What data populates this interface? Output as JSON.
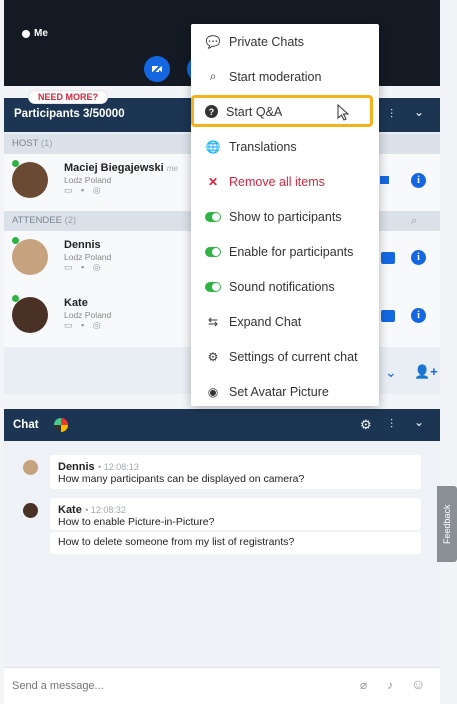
{
  "video": {
    "me_label": "Me"
  },
  "participants": {
    "badge": "NEED MORE?",
    "title": "Participants 3/50000",
    "host_section": "HOST",
    "host_count": "(1)",
    "attendee_section": "ATTENDEE",
    "attendee_count": "(2)",
    "host": {
      "name": "Maciej Biegajewski",
      "tag": "me",
      "location": "Lodz Poland"
    },
    "attendees": [
      {
        "name": "Dennis",
        "location": "Lodz Poland"
      },
      {
        "name": "Kate",
        "location": "Lodz Poland"
      }
    ]
  },
  "menu": {
    "items": [
      {
        "label": "Private Chats",
        "icon": "chats-icon"
      },
      {
        "label": "Start moderation",
        "icon": "moderation-icon"
      },
      {
        "label": "Start Q&A",
        "icon": "question-icon"
      },
      {
        "label": "Translations",
        "icon": "globe-icon"
      },
      {
        "label": "Remove all items",
        "icon": "x-icon"
      },
      {
        "label": "Show to participants",
        "icon": "toggle-on"
      },
      {
        "label": "Enable for participants",
        "icon": "toggle-on"
      },
      {
        "label": "Sound notifications",
        "icon": "toggle-on"
      },
      {
        "label": "Expand Chat",
        "icon": "expand-icon"
      },
      {
        "label": "Settings of current chat",
        "icon": "gear-icon"
      },
      {
        "label": "Set Avatar Picture",
        "icon": "avatar-icon"
      }
    ]
  },
  "chat": {
    "title": "Chat",
    "messages": [
      {
        "author": "Dennis",
        "time": "12:08:13",
        "texts": [
          "How many participants can be displayed on camera?"
        ]
      },
      {
        "author": "Kate",
        "time": "12:08:32",
        "texts": [
          "How to enable Picture-in-Picture?",
          "How to delete someone from my list of registrants?"
        ]
      }
    ],
    "input_placeholder": "Send a message..."
  },
  "feedback": "Feedback",
  "colors": {
    "header": "#1b3553",
    "accent": "#1467e0",
    "highlight": "#f2b21a",
    "danger": "#d7263d",
    "online": "#2fb344"
  }
}
